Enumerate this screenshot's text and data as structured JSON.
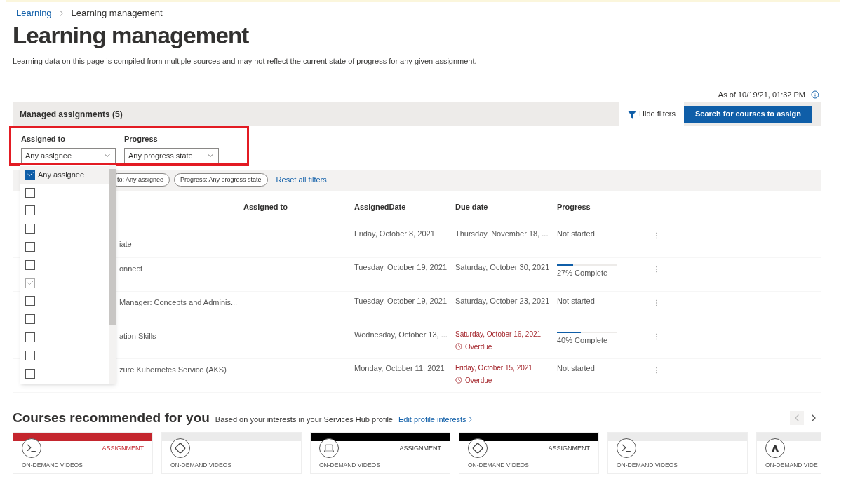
{
  "breadcrumb": [
    "Learning",
    "Learning management"
  ],
  "title": "Learning management",
  "disclaimer": "Learning data on this page is compiled from multiple sources and may not reflect the current state of progress for any given assignment.",
  "as_of": "As of 10/19/21, 01:32 PM",
  "panel": {
    "title": "Managed assignments (5)",
    "hide_filters": "Hide filters",
    "search_button": "Search for courses to assign"
  },
  "filters": [
    {
      "label": "Assigned to",
      "value": "Any assignee"
    },
    {
      "label": "Progress",
      "value": "Any progress state"
    }
  ],
  "dropdown": [
    {
      "label": "Any assignee",
      "checked": true,
      "disabled": false,
      "selected": true
    },
    {
      "checked": false,
      "disabled": false,
      "selected": false
    },
    {
      "checked": false,
      "disabled": false,
      "selected": false
    },
    {
      "checked": false,
      "disabled": false,
      "selected": false
    },
    {
      "checked": false,
      "disabled": false,
      "selected": false
    },
    {
      "checked": false,
      "disabled": false,
      "selected": false
    },
    {
      "checked": true,
      "disabled": true,
      "selected": false
    },
    {
      "checked": false,
      "disabled": false,
      "selected": false
    },
    {
      "checked": false,
      "disabled": false,
      "selected": false
    },
    {
      "checked": false,
      "disabled": false,
      "selected": false
    },
    {
      "checked": false,
      "disabled": false,
      "selected": false
    },
    {
      "checked": false,
      "disabled": false,
      "selected": false
    }
  ],
  "chips": [
    "to: Any assignee",
    "Progress: Any progress state"
  ],
  "reset": "Reset all filters",
  "table": {
    "columns": [
      "Assigned to",
      "AssignedDate",
      "Due date",
      "Progress"
    ],
    "rows": [
      {
        "course": "iate",
        "assigned": "Friday, October 8, 2021",
        "due": "Thursday, November 18, ...",
        "overdue": false,
        "progress": "Not started",
        "level": null
      },
      {
        "course": "onnect",
        "assigned": "Tuesday, October 19, 2021",
        "due": "Saturday, October 30, 2021",
        "overdue": false,
        "progress": "27% Complete",
        "level": 0.27
      },
      {
        "course": "Manager: Concepts and Adminis...",
        "assigned": "Tuesday, October 19, 2021",
        "due": "Saturday, October 23, 2021",
        "overdue": false,
        "progress": "Not started",
        "level": null
      },
      {
        "course": "ation Skills",
        "assigned": "Wednesday, October 13, ...",
        "due": "Saturday, October 16, 2021",
        "overdue": true,
        "overdue_label": "Overdue",
        "progress": "40% Complete",
        "level": 0.4
      },
      {
        "course": "zure Kubernetes Service (AKS)",
        "assigned": "Monday, October 11, 2021",
        "due": "Friday, October 15, 2021",
        "overdue": true,
        "overdue_label": "Overdue",
        "progress": "Not started",
        "level": null
      }
    ]
  },
  "recommended": {
    "title": "Courses recommended for you",
    "subtitle": "Based on your interests in your Services Hub profile",
    "link": "Edit profile interests",
    "cards": [
      {
        "kind": "terminal",
        "color": "#c4262e",
        "badge": "ASSIGNMENT",
        "category": "ON-DEMAND VIDEOS"
      },
      {
        "kind": "diamond",
        "color": "#ebebeb",
        "category": "ON-DEMAND VIDEOS"
      },
      {
        "kind": "laptop",
        "color": "#000000",
        "badge": "ASSIGNMENT",
        "category": "ON-DEMAND VIDEOS"
      },
      {
        "kind": "diamond",
        "color": "#000000",
        "badge": "ASSIGNMENT",
        "category": "ON-DEMAND VIDEOS"
      },
      {
        "kind": "terminal",
        "color": "#ebebeb",
        "category": "ON-DEMAND VIDEOS"
      },
      {
        "kind": "azure",
        "color": "#ebebeb",
        "category": "ON-DEMAND VIDE"
      }
    ]
  }
}
